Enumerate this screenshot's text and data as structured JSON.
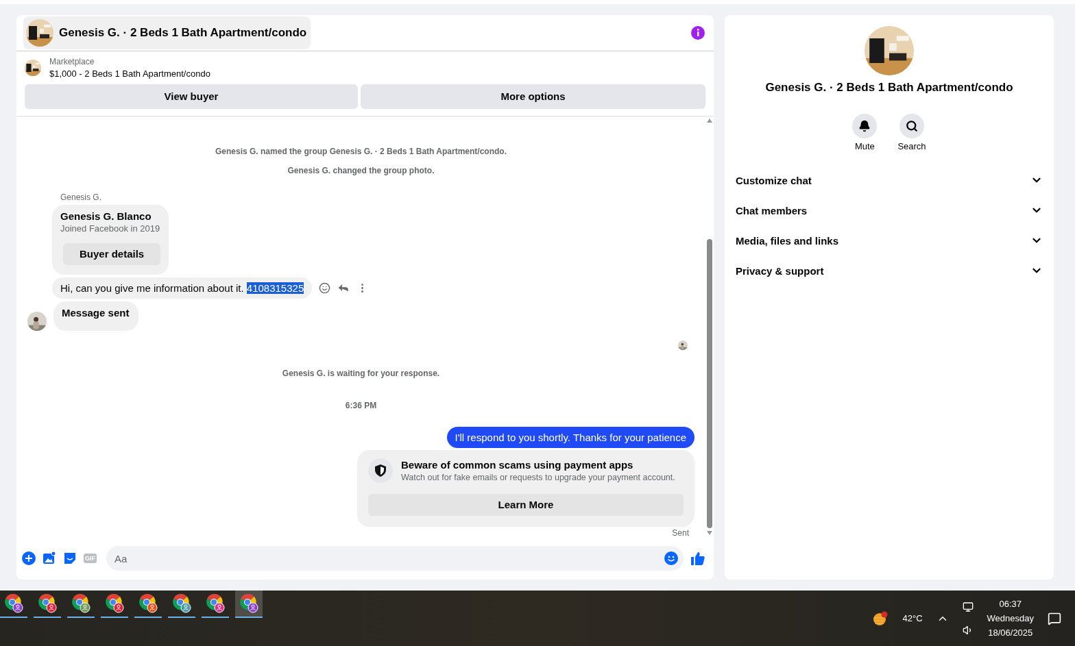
{
  "chat": {
    "title": "Genesis G. · 2 Beds 1 Bath Apartment/condo",
    "listing": {
      "source": "Marketplace",
      "summary": "$1,000 - 2 Beds 1 Bath Apartment/condo"
    },
    "actions": [
      "View buyer",
      "More options"
    ],
    "messages": [
      {
        "kind": "event",
        "text": "Genesis G. named the group Genesis G. · 2 Beds 1 Bath Apartment/condo."
      },
      {
        "kind": "event",
        "text": "Genesis G. changed the group photo."
      },
      {
        "kind": "sender",
        "text": "Genesis G."
      },
      {
        "kind": "card",
        "title": "Genesis G. Blanco",
        "subtitle": "Joined Facebook in 2019",
        "button": "Buyer details"
      },
      {
        "kind": "incoming",
        "text": "Hi, can you give me information about it.",
        "selected_text": "4108315325"
      },
      {
        "kind": "incoming_bold",
        "text": "Message sent"
      },
      {
        "kind": "seen"
      },
      {
        "kind": "event",
        "text": "Genesis G. is waiting for your response."
      },
      {
        "kind": "time",
        "text": "6:36 PM"
      },
      {
        "kind": "outgoing",
        "text": "I'll respond to you shortly. Thanks for your patience"
      },
      {
        "kind": "notice",
        "title": "Beware of common scams using payment apps",
        "text": "Watch out for fake emails or requests to upgrade your payment account.",
        "button": "Learn More"
      },
      {
        "kind": "status",
        "text": "Sent"
      }
    ],
    "composer": {
      "gif_label": "GIF",
      "placeholder": "Aa"
    }
  },
  "details": {
    "title": "Genesis G. · 2 Beds 1 Bath Apartment/condo",
    "actions": [
      {
        "kind": "mute",
        "label": "Mute"
      },
      {
        "kind": "search",
        "label": "Search"
      }
    ],
    "sections": [
      {
        "label": "Customize chat",
        "expanded": false
      },
      {
        "label": "Chat members",
        "expanded": false
      },
      {
        "label": "Media, files and links",
        "expanded": false
      },
      {
        "label": "Privacy & support",
        "expanded": false
      }
    ]
  },
  "taskbar": {
    "apps": [
      {
        "color": "#8e3fd0",
        "selected": false
      },
      {
        "color": "#e0203a",
        "selected": false
      },
      {
        "color": "#6e9a5a",
        "selected": false
      },
      {
        "color": "#e0203a",
        "selected": false
      },
      {
        "color": "#e8501a",
        "selected": false
      },
      {
        "color": "#4a9aa8",
        "selected": false
      },
      {
        "color": "#d8358a",
        "selected": false
      },
      {
        "color": "#8e3fd0",
        "selected": true
      }
    ],
    "weather": "42°C",
    "time": "06:37",
    "day": "Wednesday",
    "date": "18/06/2025"
  }
}
